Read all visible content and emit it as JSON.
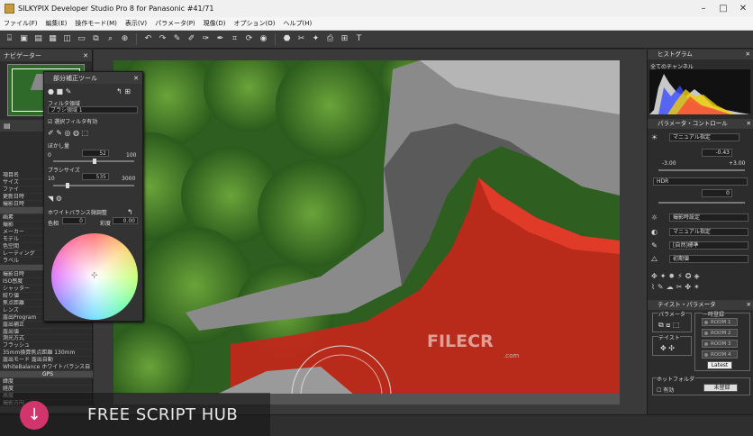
{
  "window": {
    "title": "SILKYPIX Developer Studio Pro 8 for Panasonic   #41/71"
  },
  "menu": [
    "ファイル(F)",
    "編集(E)",
    "操作モード(M)",
    "表示(V)",
    "パラメータ(P)",
    "現像(D)",
    "オプション(O)",
    "ヘルプ(H)"
  ],
  "left": {
    "navigator_title": "ナビゲーター",
    "info_rows": [
      {
        "t": "項目名",
        "h": false
      },
      {
        "t": "サイズ",
        "h": false
      },
      {
        "t": "ファイ",
        "h": false
      },
      {
        "t": "更新日時",
        "h": false
      },
      {
        "t": "撮影日時",
        "h": false
      },
      {
        "t": "",
        "h": true
      },
      {
        "t": "画素",
        "h": false
      },
      {
        "t": "撮影",
        "h": false
      },
      {
        "t": "メーカー",
        "h": false
      },
      {
        "t": "モデル",
        "h": false
      },
      {
        "t": "色空間",
        "h": false
      },
      {
        "t": "レーティング",
        "h": false
      },
      {
        "t": "ラベル",
        "h": false
      },
      {
        "t": "",
        "h": true
      },
      {
        "t": "撮影日時",
        "h": false
      },
      {
        "t": "ISO感度",
        "h": false
      },
      {
        "t": "シャッター",
        "h": false
      },
      {
        "t": "絞り値",
        "h": false
      },
      {
        "t": "焦点距離",
        "h": false
      },
      {
        "t": "レンズ",
        "h": false
      },
      {
        "t": "露出Program",
        "h": false
      },
      {
        "t": "露出補正",
        "h": false
      },
      {
        "t": "露出値",
        "h": false
      },
      {
        "t": "測光方式",
        "h": false
      },
      {
        "t": "フラッシュ",
        "h": false
      },
      {
        "t": "35mm換算焦点距離 130mm",
        "h": false
      },
      {
        "t": "露出モード  露出自動",
        "h": false
      },
      {
        "t": "WhiteBalance ホワイトバランス自",
        "h": false
      },
      {
        "t": "GPS",
        "h": true
      },
      {
        "t": "緯度",
        "h": false
      },
      {
        "t": "経度",
        "h": false
      },
      {
        "t": "高度",
        "h": false
      },
      {
        "t": "撮影方向",
        "h": false
      },
      {
        "t": "",
        "h": true
      }
    ]
  },
  "partial_tool": {
    "title": "部分補正ツール",
    "filter_label": "フィルタ領域",
    "brush_label": "ブラシ領域 1",
    "checkbox_label": "選択フィルタ有効",
    "blur_label": "ぼかし量",
    "blur_value": "52",
    "blur_min": "0",
    "blur_max": "100",
    "brush_size_label": "ブラシサイズ",
    "brush_size_value": "535",
    "brush_size_min": "10",
    "brush_size_max": "3000",
    "wb_label": "ホワイトバランス微調整",
    "hue_label": "色相",
    "hue_value": "0",
    "sat_label": "彩度",
    "sat_value": "0.00"
  },
  "right": {
    "histogram_title": "ヒストグラム",
    "histogram_channel": "全てのチャンネル",
    "param_title": "パラメータ・コントロール",
    "exposure_mode": "マニュアル指定",
    "exposure_value": "-0.43",
    "exposure_min": "-3.00",
    "exposure_max": "+3.00",
    "hdr_label": "HDR",
    "hdr_value": "0",
    "wb_shoot": "撮影時設定",
    "wb_manual": "マニュアル指定",
    "tone_label": "[自然]標準",
    "sharp_label": "初期値",
    "taste_title": "テイスト・パラメータ",
    "param_group": "パラメータ",
    "taste_group": "テイスト",
    "temp_group": "一時登録",
    "room_slots": [
      "ROOM 1",
      "ROOM 2",
      "ROOM 3",
      "ROOM 4"
    ],
    "latest_label": "Latest",
    "hotfolder_label": "ホットフォルダ",
    "hotfolder_enable": "有効",
    "hotfolder_unreg": "未登録"
  },
  "overlay": {
    "filecr": "FILECR",
    "filecr_domain": ".com",
    "banner": "FREE SCRIPT HUB"
  },
  "colors": {
    "accent_pink": "#d2356b",
    "red_mask": "#c4261a"
  }
}
